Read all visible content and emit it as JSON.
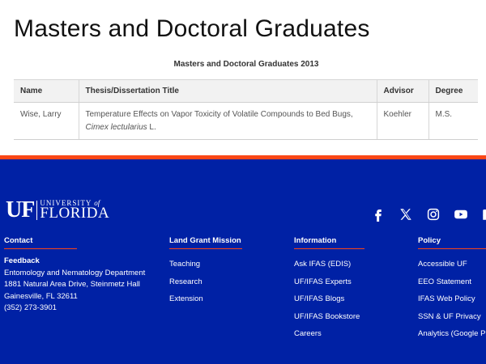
{
  "page": {
    "title": "Masters and Doctoral Graduates"
  },
  "table": {
    "caption": "Masters and Doctoral Graduates 2013",
    "headers": [
      "Name",
      "Thesis/Dissertation Title",
      "Advisor",
      "Degree"
    ],
    "rows": [
      {
        "name": "Wise, Larry",
        "title_prefix": "Temperature Effects on Vapor Toxicity of Volatile Compounds to Bed Bugs,",
        "title_italic": "Cimex lectularius",
        "title_suffix": "L.",
        "advisor": "Koehler",
        "degree": "M.S."
      }
    ]
  },
  "colors": {
    "footer_bg": "#0021a5",
    "accent": "#fa4616"
  },
  "footer": {
    "logo": {
      "mark": "UF",
      "top": "UNIVERSITY",
      "of": "of",
      "bottom": "FLORIDA"
    },
    "social": [
      "facebook-icon",
      "x-icon",
      "instagram-icon",
      "youtube-icon",
      "podcast-icon"
    ],
    "contact": {
      "heading": "Contact",
      "feedback": "Feedback",
      "dept": "Entomology and Nematology Department",
      "address1": "1881 Natural Area Drive, Steinmetz Hall",
      "address2": "Gainesville, FL 32611",
      "phone": "(352) 273-3901"
    },
    "land_grant": {
      "heading": "Land Grant Mission",
      "links": [
        "Teaching",
        "Research",
        "Extension"
      ]
    },
    "information": {
      "heading": "Information",
      "links": [
        "Ask IFAS (EDIS)",
        "UF/IFAS Experts",
        "UF/IFAS Blogs",
        "UF/IFAS Bookstore",
        "Careers"
      ]
    },
    "policy": {
      "heading": "Policy",
      "links": [
        "Accessible UF",
        "EEO Statement",
        "IFAS Web Policy",
        "SSN & UF Privacy",
        "Analytics (Google Pr"
      ]
    }
  }
}
